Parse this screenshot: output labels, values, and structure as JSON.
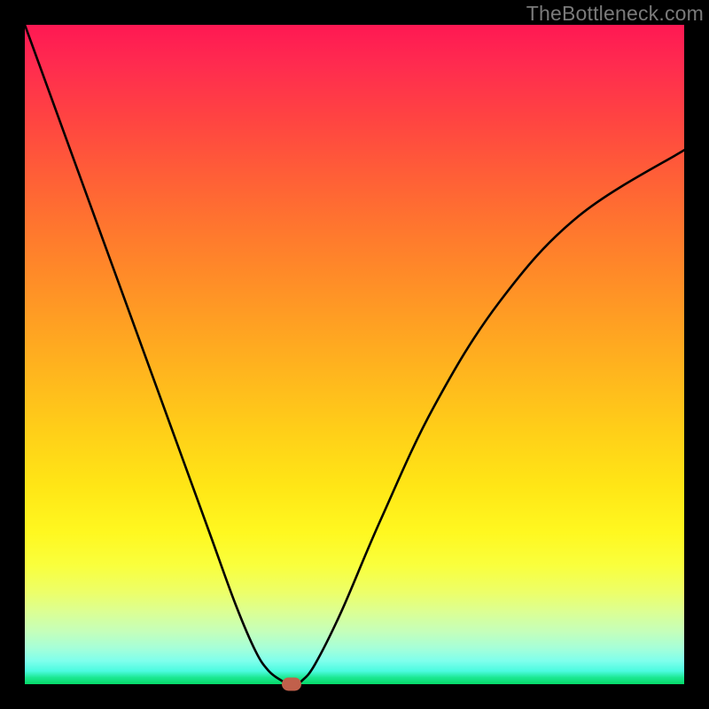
{
  "watermark": "TheBottleneck.com",
  "chart_data": {
    "type": "line",
    "title": "",
    "xlabel": "",
    "ylabel": "",
    "xlim": [
      0,
      100
    ],
    "ylim": [
      0,
      100
    ],
    "grid": false,
    "series": [
      {
        "name": "curve",
        "x": [
          0,
          4,
          8,
          12,
          16,
          20,
          24,
          28,
          32,
          35,
          37,
          39,
          40,
          41,
          42,
          44,
          48,
          54,
          62,
          72,
          84,
          100
        ],
        "y": [
          100,
          89,
          78,
          67,
          56,
          45,
          34,
          23,
          12,
          5,
          2,
          0.5,
          0,
          0,
          0.5,
          3,
          11,
          25,
          42,
          58,
          71,
          81
        ]
      }
    ],
    "marker": {
      "x": 40.5,
      "y": 0
    },
    "background_gradient": {
      "top_color": "#ff1853",
      "mid_color": "#ffe616",
      "bottom_color": "#05d968"
    }
  }
}
